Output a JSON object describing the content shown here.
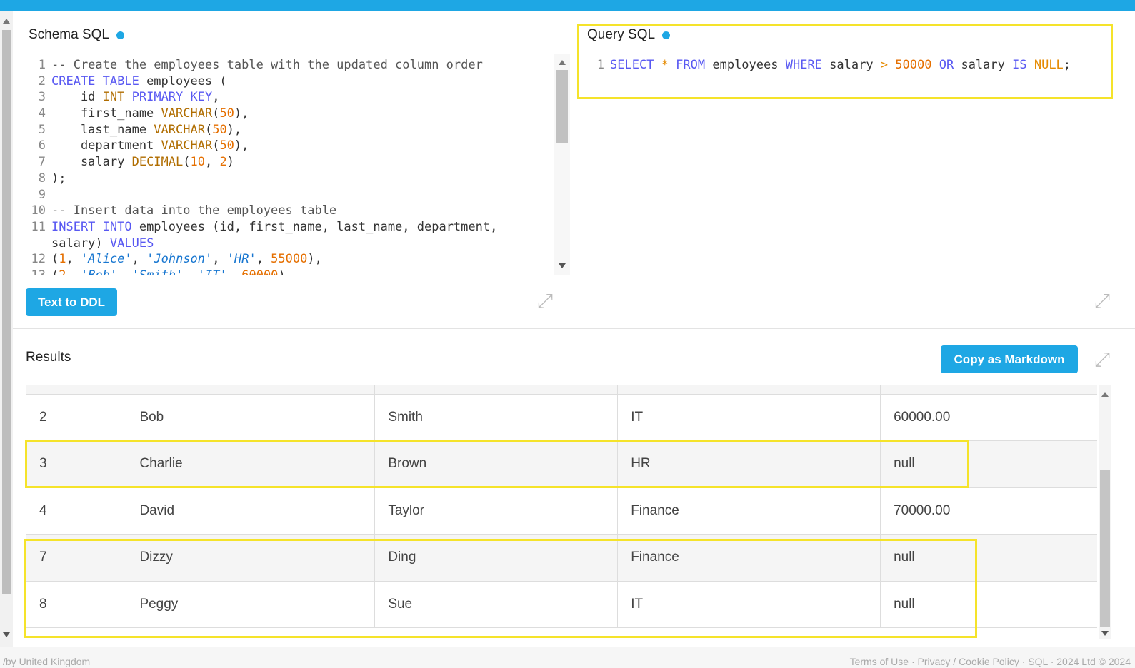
{
  "schema": {
    "title": "Schema SQL",
    "button": "Text to DDL"
  },
  "query": {
    "title": "Query SQL"
  },
  "results": {
    "title": "Results",
    "copy_button": "Copy as Markdown",
    "rows": [
      [
        "2",
        "Bob",
        "Smith",
        "IT",
        "60000.00"
      ],
      [
        "3",
        "Charlie",
        "Brown",
        "HR",
        "null"
      ],
      [
        "4",
        "David",
        "Taylor",
        "Finance",
        "70000.00"
      ],
      [
        "7",
        "Dizzy",
        "Ding",
        "Finance",
        "null"
      ],
      [
        "8",
        "Peggy",
        "Sue",
        "IT",
        "null"
      ]
    ]
  },
  "footer": {
    "left": "/by United Kingdom",
    "right": "Terms of Use · Privacy / Cookie Policy · SQL · 2024 Ltd © 2024"
  },
  "colors": {
    "accent": "#1ea7e4",
    "highlight": "#f5e32a"
  }
}
